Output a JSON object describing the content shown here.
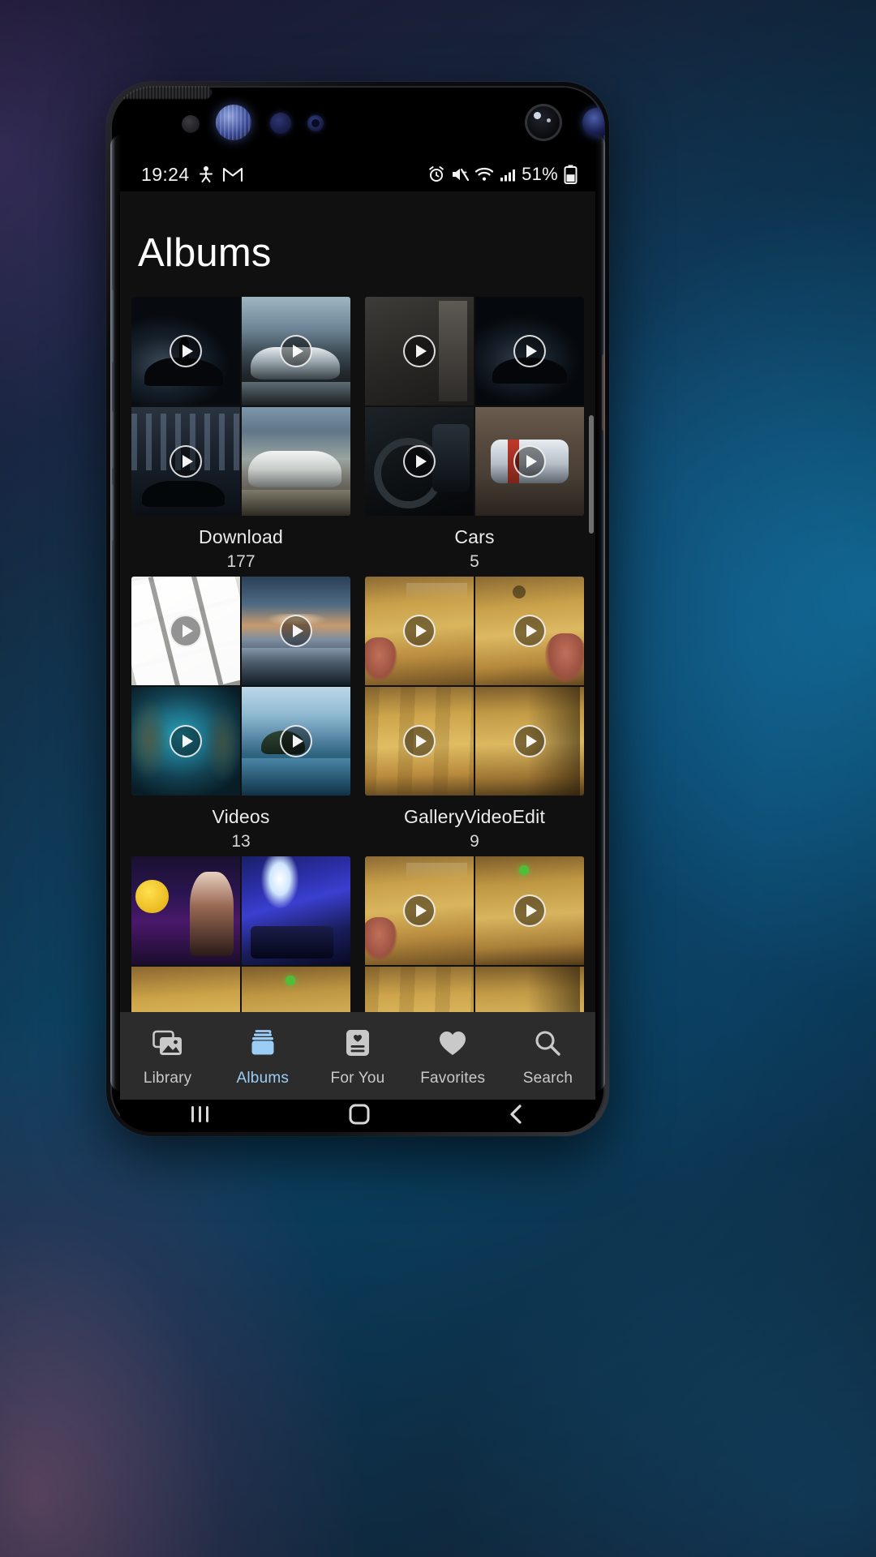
{
  "statusbar": {
    "time": "19:24",
    "left_icons": [
      "person-activity-icon",
      "gmail-icon"
    ],
    "right_icons": [
      "alarm-icon",
      "mute-icon",
      "wifi-icon",
      "signal-icon"
    ],
    "battery_percent": "51%",
    "battery_level": 51
  },
  "header": {
    "title": "Albums"
  },
  "albums": [
    {
      "name": "Download",
      "count": "177",
      "thumbs": [
        {
          "art": "a-dark-boat",
          "play": true,
          "alt": "dark-boat-silhouette"
        },
        {
          "art": "a-car-road",
          "play": true,
          "alt": "sports-car-on-road"
        },
        {
          "art": "a-city-night",
          "play": true,
          "alt": "city-street-night"
        },
        {
          "art": "a-white-car",
          "play": false,
          "alt": "white-stance-car"
        }
      ]
    },
    {
      "name": "Cars",
      "count": "5",
      "thumbs": [
        {
          "art": "a-blank-gray",
          "play": true,
          "alt": "gray-blank-frame"
        },
        {
          "art": "a-dark-boat2",
          "play": true,
          "alt": "dark-silhouette-scene"
        },
        {
          "art": "a-car-interior",
          "play": true,
          "alt": "car-steering-wheel-interior"
        },
        {
          "art": "a-car-ramp",
          "play": true,
          "alt": "car-on-ramp"
        }
      ]
    },
    {
      "name": "Videos",
      "count": "13",
      "thumbs": [
        {
          "art": "a-keyboard",
          "play": true,
          "alt": "white-keyboard-keys"
        },
        {
          "art": "a-lake-sunset",
          "play": true,
          "alt": "lake-at-sunset"
        },
        {
          "art": "a-cave",
          "play": true,
          "alt": "underwater-cave"
        },
        {
          "art": "a-island",
          "play": true,
          "alt": "island-on-lake"
        }
      ]
    },
    {
      "name": "GalleryVideoEdit",
      "count": "9",
      "thumbs": [
        {
          "art": "a-hand-wood1",
          "play": true,
          "alt": "hand-on-wood-floor"
        },
        {
          "art": "a-hand-wood2",
          "play": true,
          "alt": "hands-on-wood-floor"
        },
        {
          "art": "a-wood-plain",
          "play": true,
          "alt": "wooden-floor"
        },
        {
          "art": "a-wood-shadow",
          "play": true,
          "alt": "wooden-floor-shadow"
        }
      ]
    },
    {
      "name": "",
      "count": "",
      "thumbs": [
        {
          "art": "a-tv-show",
          "play": false,
          "alt": "tv-show-screenshot"
        },
        {
          "art": "a-rgb-desk",
          "play": false,
          "alt": "rgb-lit-desk-setup"
        },
        {
          "art": "a-hand-wood3",
          "play": true,
          "alt": "hand-on-wood-floor"
        },
        {
          "art": "a-wood-green",
          "play": true,
          "alt": "wood-floor-green-light"
        }
      ]
    }
  ],
  "bottom_nav": {
    "active_color": "#9ccdf5",
    "inactive_color": "#c9c9c9",
    "items": [
      {
        "label": "Library",
        "icon": "photo-stack-icon",
        "active": false
      },
      {
        "label": "Albums",
        "icon": "albums-stack-icon",
        "active": true
      },
      {
        "label": "For You",
        "icon": "for-you-card-icon",
        "active": false
      },
      {
        "label": "Favorites",
        "icon": "heart-icon",
        "active": false
      },
      {
        "label": "Search",
        "icon": "search-icon",
        "active": false
      }
    ]
  },
  "android_nav": {
    "recents": "recents-button",
    "home": "home-button",
    "back": "back-button"
  }
}
